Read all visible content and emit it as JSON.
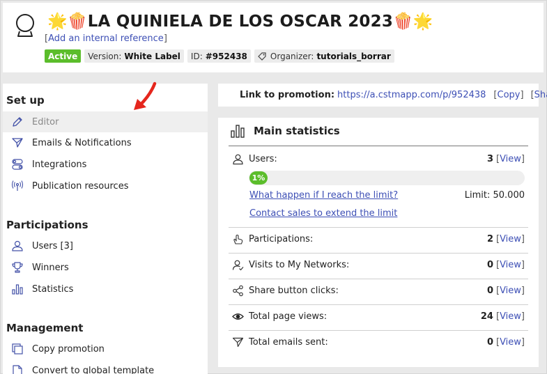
{
  "header": {
    "title_prefix_emoji": "🌟🍿",
    "title": "LA QUINIELA DE LOS OSCAR 2023",
    "title_suffix_emoji": "🍿🌟",
    "internal_ref_open": "[",
    "internal_ref_link": "Add an internal reference",
    "internal_ref_close": "]",
    "badges": {
      "status": "Active",
      "version_label": "Version:",
      "version_value": "White Label",
      "id_label": "ID:",
      "id_value": "#952438",
      "organizer_label": "Organizer:",
      "organizer_value": "tutorials_borrar"
    }
  },
  "sidebar": {
    "setup_title": "Set up",
    "setup_items": [
      {
        "label": "Editor",
        "icon": "pencil-icon"
      },
      {
        "label": "Emails & Notifications",
        "icon": "paper-plane-icon"
      },
      {
        "label": "Integrations",
        "icon": "toggles-icon"
      },
      {
        "label": "Publication resources",
        "icon": "broadcast-icon"
      }
    ],
    "participations_title": "Participations",
    "participations_items": [
      {
        "label": "Users [3]",
        "icon": "user-icon"
      },
      {
        "label": "Winners",
        "icon": "trophy-icon"
      },
      {
        "label": "Statistics",
        "icon": "bar-chart-icon"
      }
    ],
    "management_title": "Management",
    "management_items": [
      {
        "label": "Copy promotion",
        "icon": "copy-icon"
      },
      {
        "label": "Convert to global template",
        "icon": "document-icon"
      }
    ]
  },
  "link_bar": {
    "label": "Link to promotion:",
    "url": "https://a.cstmapp.com/p/952438",
    "copy": "Copy",
    "share": "Share"
  },
  "stats": {
    "title": "Main statistics",
    "users_label": "Users:",
    "users_value": "3",
    "users_progress_text": "1%",
    "users_progress_fraction": 0.01,
    "limit_question": "What happen if I reach the limit?",
    "limit_text": "Limit: 50.000",
    "contact_sales": "Contact sales to extend the limit",
    "view": "View",
    "rows": [
      {
        "label": "Participations:",
        "value": "2",
        "icon": "hand-icon"
      },
      {
        "label": "Visits to My Networks:",
        "value": "0",
        "icon": "user-check-icon"
      },
      {
        "label": "Share button clicks:",
        "value": "0",
        "icon": "share-icon"
      },
      {
        "label": "Total page views:",
        "value": "24",
        "icon": "eye-icon"
      },
      {
        "label": "Total emails sent:",
        "value": "0",
        "icon": "paper-plane-icon"
      }
    ]
  },
  "colors": {
    "active_green": "#5bbd2b",
    "link_blue": "#3d4fb5",
    "arrow_red": "#e5261d"
  }
}
